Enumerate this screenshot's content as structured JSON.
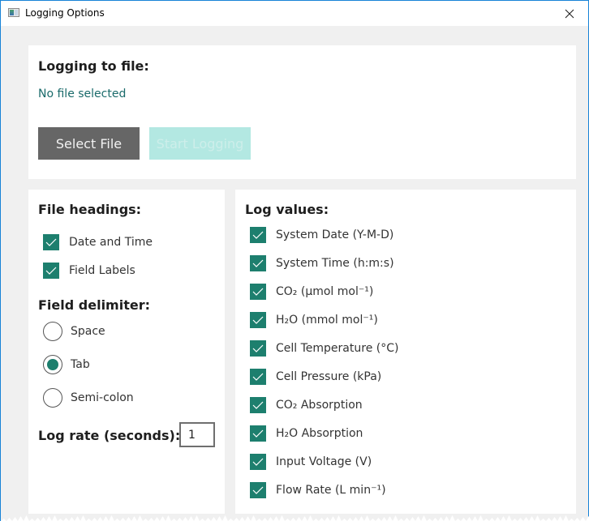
{
  "window": {
    "title": "Logging Options",
    "icon": "app-window-icon",
    "close_icon": "close-icon"
  },
  "logging_to_file": {
    "heading": "Logging to file:",
    "status": "No file selected",
    "select_file_label": "Select File",
    "start_logging_label": "Start Logging",
    "start_logging_enabled": false
  },
  "file_headings": {
    "heading": "File headings:",
    "items": [
      {
        "label": "Date and Time",
        "checked": true
      },
      {
        "label": "Field Labels",
        "checked": true
      }
    ]
  },
  "field_delimiter": {
    "heading": "Field delimiter:",
    "options": [
      {
        "label": "Space",
        "selected": false
      },
      {
        "label": "Tab",
        "selected": true
      },
      {
        "label": "Semi-colon",
        "selected": false
      }
    ]
  },
  "log_rate": {
    "label": "Log rate (seconds):",
    "value": "1"
  },
  "log_values": {
    "heading": "Log values:",
    "items": [
      {
        "label": "System Date (Y-M-D)",
        "checked": true
      },
      {
        "label": "System Time (h:m:s)",
        "checked": true
      },
      {
        "label": "CO₂ (µmol mol⁻¹)",
        "checked": true
      },
      {
        "label": "H₂O (mmol mol⁻¹)",
        "checked": true
      },
      {
        "label": "Cell Temperature (°C)",
        "checked": true
      },
      {
        "label": "Cell Pressure (kPa)",
        "checked": true
      },
      {
        "label": "CO₂ Absorption",
        "checked": true
      },
      {
        "label": "H₂O Absorption",
        "checked": true
      },
      {
        "label": "Input Voltage (V)",
        "checked": true
      },
      {
        "label": "Flow Rate (L min⁻¹)",
        "checked": true
      }
    ]
  },
  "colors": {
    "accent": "#1d7f6e",
    "status_text": "#1a6b6b",
    "select_button": "#666666",
    "start_button_disabled": "#b3e8e2",
    "window_border": "#1883d7",
    "background": "#f0f0f0"
  }
}
